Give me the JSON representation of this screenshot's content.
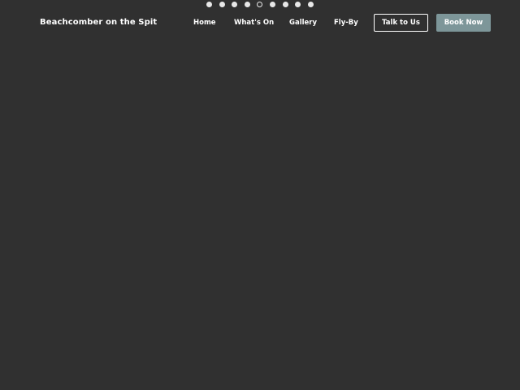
{
  "slider": {
    "dot_count": 9,
    "active_index": 4
  },
  "header": {
    "brand": "Beachcomber on the Spit",
    "nav": [
      {
        "label": "Home"
      },
      {
        "label": "What's On"
      },
      {
        "label": "Gallery"
      },
      {
        "label": "Fly-By"
      }
    ],
    "talk_button": "Talk to Us",
    "book_button": "Book Now"
  },
  "colors": {
    "background": "#303030",
    "book_button": "#7d9699",
    "text": "#ffffff"
  }
}
